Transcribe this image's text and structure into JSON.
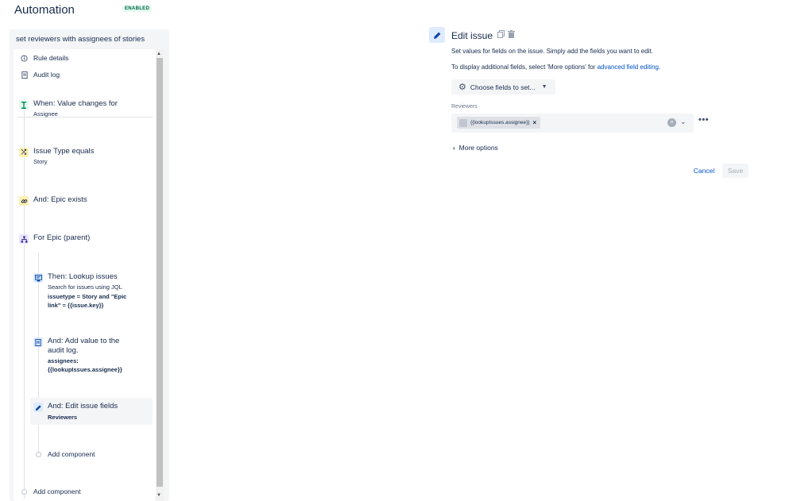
{
  "header": {
    "title": "Automation",
    "status_badge": "ENABLED"
  },
  "rule": {
    "name": "set reviewers with assignees of stories",
    "meta": [
      {
        "label": "Rule details",
        "icon": "info-icon"
      },
      {
        "label": "Audit log",
        "icon": "document-icon"
      }
    ],
    "steps": {
      "trigger": {
        "title": "When: Value changes for",
        "sub": "Assignee",
        "icon": "trigger-icon"
      },
      "condition": {
        "title": "Issue Type equals",
        "sub": "Story",
        "icon": "shuffle-icon"
      },
      "epic_exists": {
        "title": "And: Epic exists",
        "icon": "link-icon"
      },
      "branch": {
        "title": "For Epic (parent)",
        "icon": "hierarchy-icon"
      },
      "lookup": {
        "title": "Then: Lookup issues",
        "sub": "Search for issues using JQL",
        "bold1": "issuetype = Story and \"Epic",
        "bold2": "link\" = {{issue.key}}",
        "icon": "lookup-icon"
      },
      "audit": {
        "title1": "And: Add value to the",
        "title2": "audit log.",
        "bold1": "assignees:",
        "bold2": "{{lookupIssues.assignee}}",
        "icon": "document-icon"
      },
      "edit": {
        "title": "And: Edit issue fields",
        "sub": "Reviewers",
        "icon": "pencil-icon"
      }
    },
    "add_component_inner": "Add component",
    "add_component_outer": "Add component"
  },
  "editor": {
    "title": "Edit issue",
    "description1": "Set values for fields on the issue. Simply add the fields you want to edit.",
    "description2_prefix": "To display additional fields, select 'More options' for ",
    "description2_link": "advanced field editing",
    "description2_suffix": ".",
    "choose_fields_label": "Choose fields to set...",
    "field_label": "Reviewers",
    "field_chip": "{{lookupIssues.assignee}}",
    "more_options_label": "More options",
    "cancel_label": "Cancel",
    "save_label": "Save"
  },
  "colors": {
    "accent": "#0052cc",
    "enabled_badge_bg": "#e3fcef",
    "enabled_badge_text": "#006644"
  }
}
